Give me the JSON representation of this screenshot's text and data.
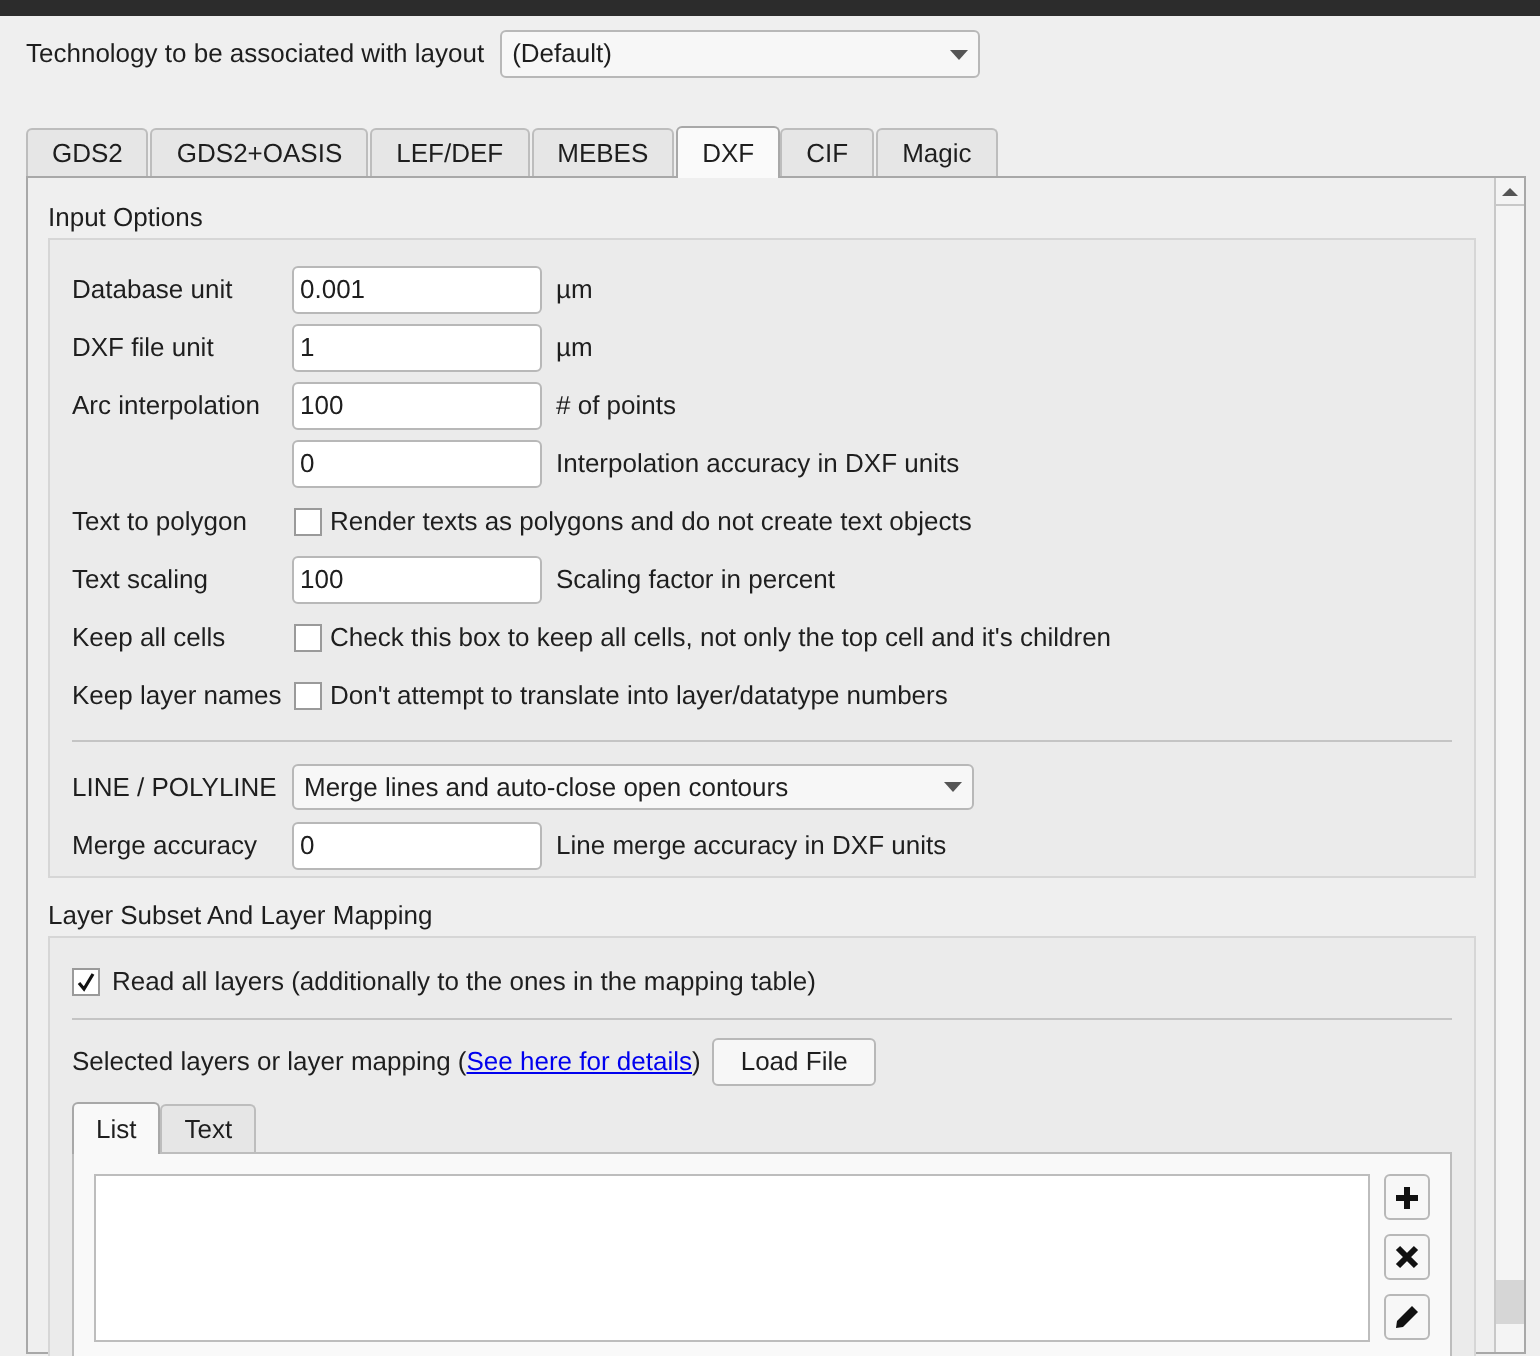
{
  "technology": {
    "label": "Technology to be associated with layout",
    "value": "(Default)"
  },
  "tabs": [
    {
      "label": "GDS2",
      "selected": false
    },
    {
      "label": "GDS2+OASIS",
      "selected": false
    },
    {
      "label": "LEF/DEF",
      "selected": false
    },
    {
      "label": "MEBES",
      "selected": false
    },
    {
      "label": "DXF",
      "selected": true
    },
    {
      "label": "CIF",
      "selected": false
    },
    {
      "label": "Magic",
      "selected": false
    }
  ],
  "input_options": {
    "title": "Input Options",
    "rows": [
      {
        "kind": "field",
        "label": "Database unit",
        "value": "0.001",
        "unit": "µm"
      },
      {
        "kind": "field",
        "label": "DXF file unit",
        "value": "1",
        "unit": "µm"
      },
      {
        "kind": "field",
        "label": "Arc interpolation",
        "value": "100",
        "unit": "# of points"
      },
      {
        "kind": "field",
        "value": "0",
        "unit": "Interpolation accuracy in DXF units"
      },
      {
        "kind": "checkbox",
        "label": "Text to polygon",
        "checked": false,
        "text": "Render texts as polygons and do not create text objects"
      },
      {
        "kind": "field",
        "label": "Text scaling",
        "value": "100",
        "unit": "Scaling factor in percent"
      },
      {
        "kind": "checkbox",
        "label": "Keep all cells",
        "checked": false,
        "text": "Check this box to keep all cells, not only the top cell and it's children"
      },
      {
        "kind": "checkbox",
        "label": "Keep layer names",
        "checked": false,
        "text": "Don't attempt to translate into layer/datatype numbers"
      },
      {
        "kind": "select",
        "label": "LINE / POLYLINE",
        "value": "Merge lines and auto-close open contours"
      },
      {
        "kind": "field",
        "label": "Merge accuracy",
        "value": "0",
        "unit": "Line merge accuracy in DXF units"
      }
    ]
  },
  "layer_mapping": {
    "title": "Layer Subset And Layer Mapping",
    "read_all": {
      "text": "Read all layers (additionally to the ones in the mapping table)",
      "checked": true
    },
    "mapping_text": "Selected layers or layer mapping (",
    "link": "See here for details",
    "mapping_text_end": ")",
    "load_button": "Load File",
    "subtabs": [
      {
        "label": "List",
        "selected": true
      },
      {
        "label": "Text",
        "selected": false
      }
    ],
    "side_buttons": [
      {
        "kind": "add"
      },
      {
        "kind": "delete"
      },
      {
        "kind": "edit"
      }
    ]
  }
}
